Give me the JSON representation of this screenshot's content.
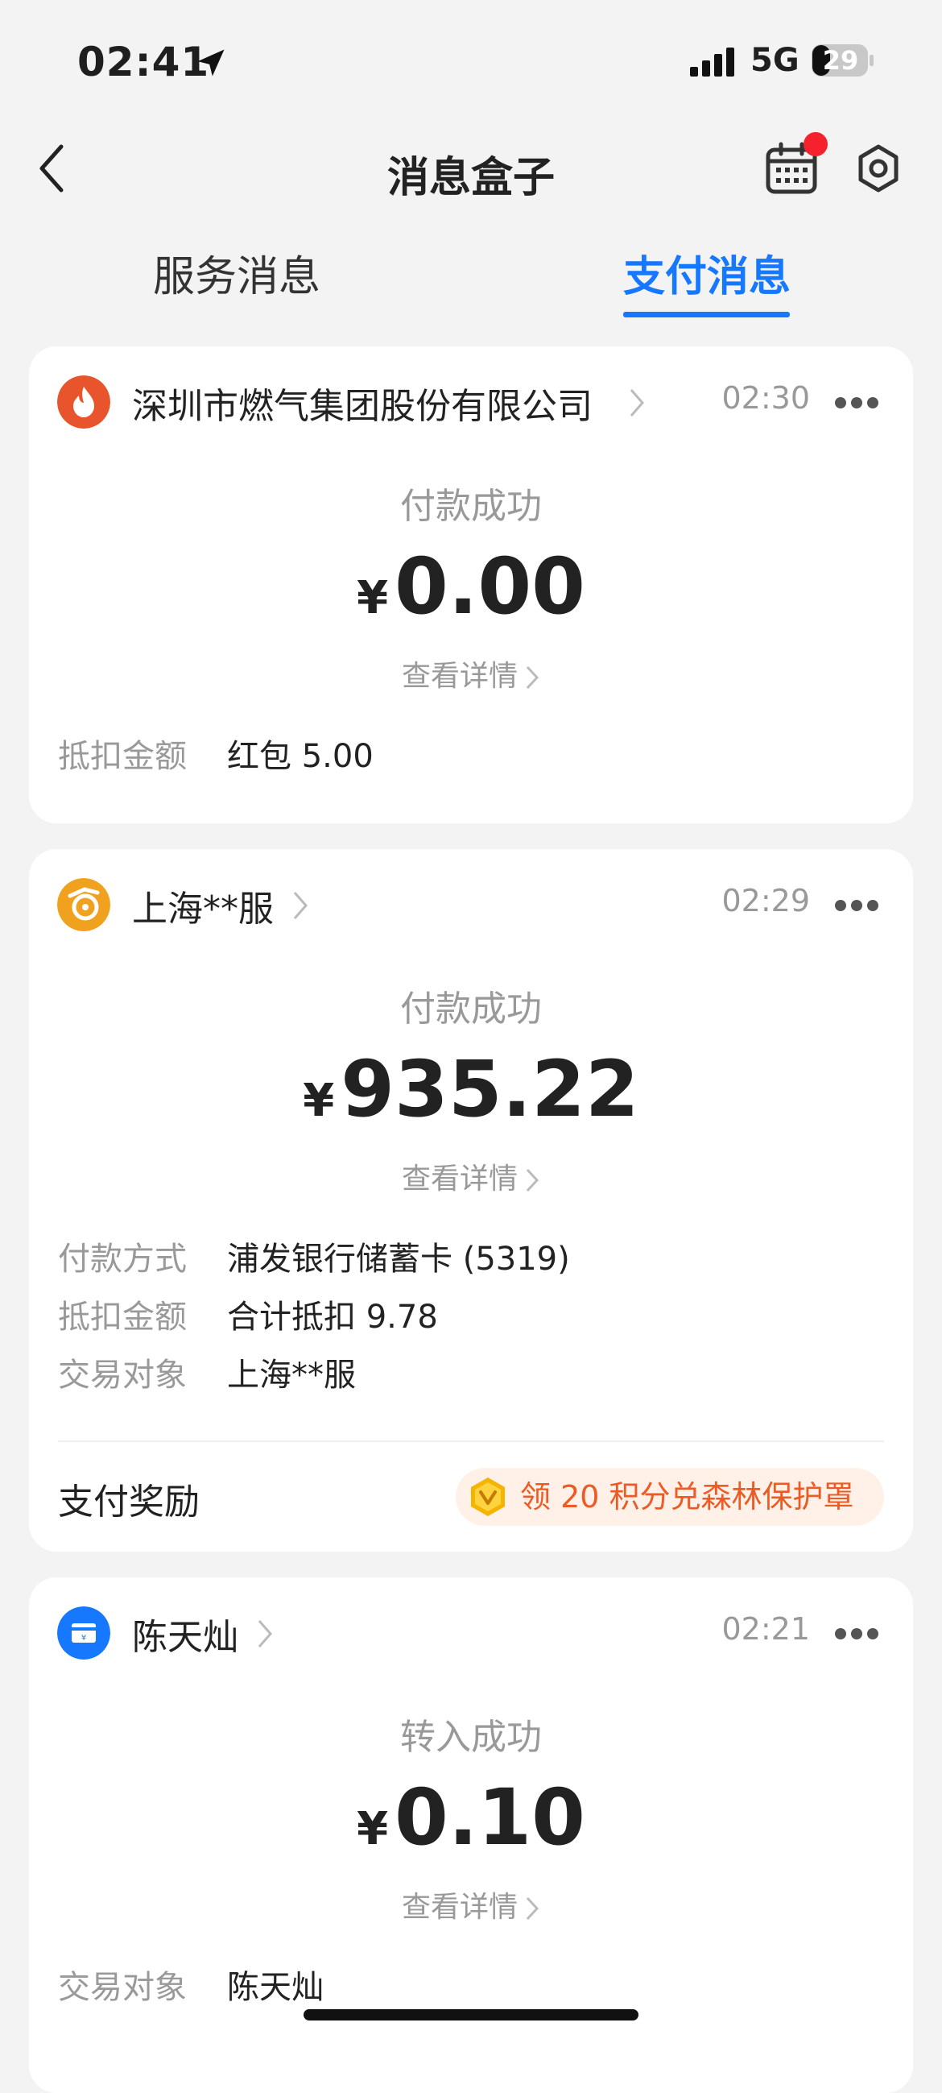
{
  "status_bar": {
    "time": "02:41",
    "network": "5G",
    "battery": "29"
  },
  "header": {
    "title": "消息盒子"
  },
  "tabs": [
    {
      "label": "服务消息",
      "active": false
    },
    {
      "label": "支付消息",
      "active": true
    }
  ],
  "colors": {
    "accent": "#1677ff",
    "badge": "#f5222d",
    "reward": "#ee5a24"
  },
  "cards": [
    {
      "merchant": "深圳市燃气集团股份有限公司",
      "icon": "flame-icon",
      "time": "02:30",
      "status": "付款成功",
      "currency": "¥",
      "amount": "0.00",
      "detail": "查看详情",
      "rows": [
        {
          "label": "抵扣金额",
          "value": "红包 5.00"
        }
      ]
    },
    {
      "merchant": "上海**服",
      "icon": "merchant-logo-icon",
      "time": "02:29",
      "status": "付款成功",
      "currency": "¥",
      "amount": "935.22",
      "detail": "查看详情",
      "rows": [
        {
          "label": "付款方式",
          "value": "浦发银行储蓄卡 (5319)"
        },
        {
          "label": "抵扣金额",
          "value": "合计抵扣 9.78"
        },
        {
          "label": "交易对象",
          "value": "上海**服"
        }
      ],
      "reward_label": "支付奖励",
      "reward_text": "领 20 积分兑森林保护罩"
    },
    {
      "merchant": "陈天灿",
      "icon": "transfer-icon",
      "time": "02:21",
      "status": "转入成功",
      "currency": "¥",
      "amount": "0.10",
      "detail": "查看详情",
      "rows": [
        {
          "label": "交易对象",
          "value": "陈天灿"
        }
      ]
    }
  ]
}
